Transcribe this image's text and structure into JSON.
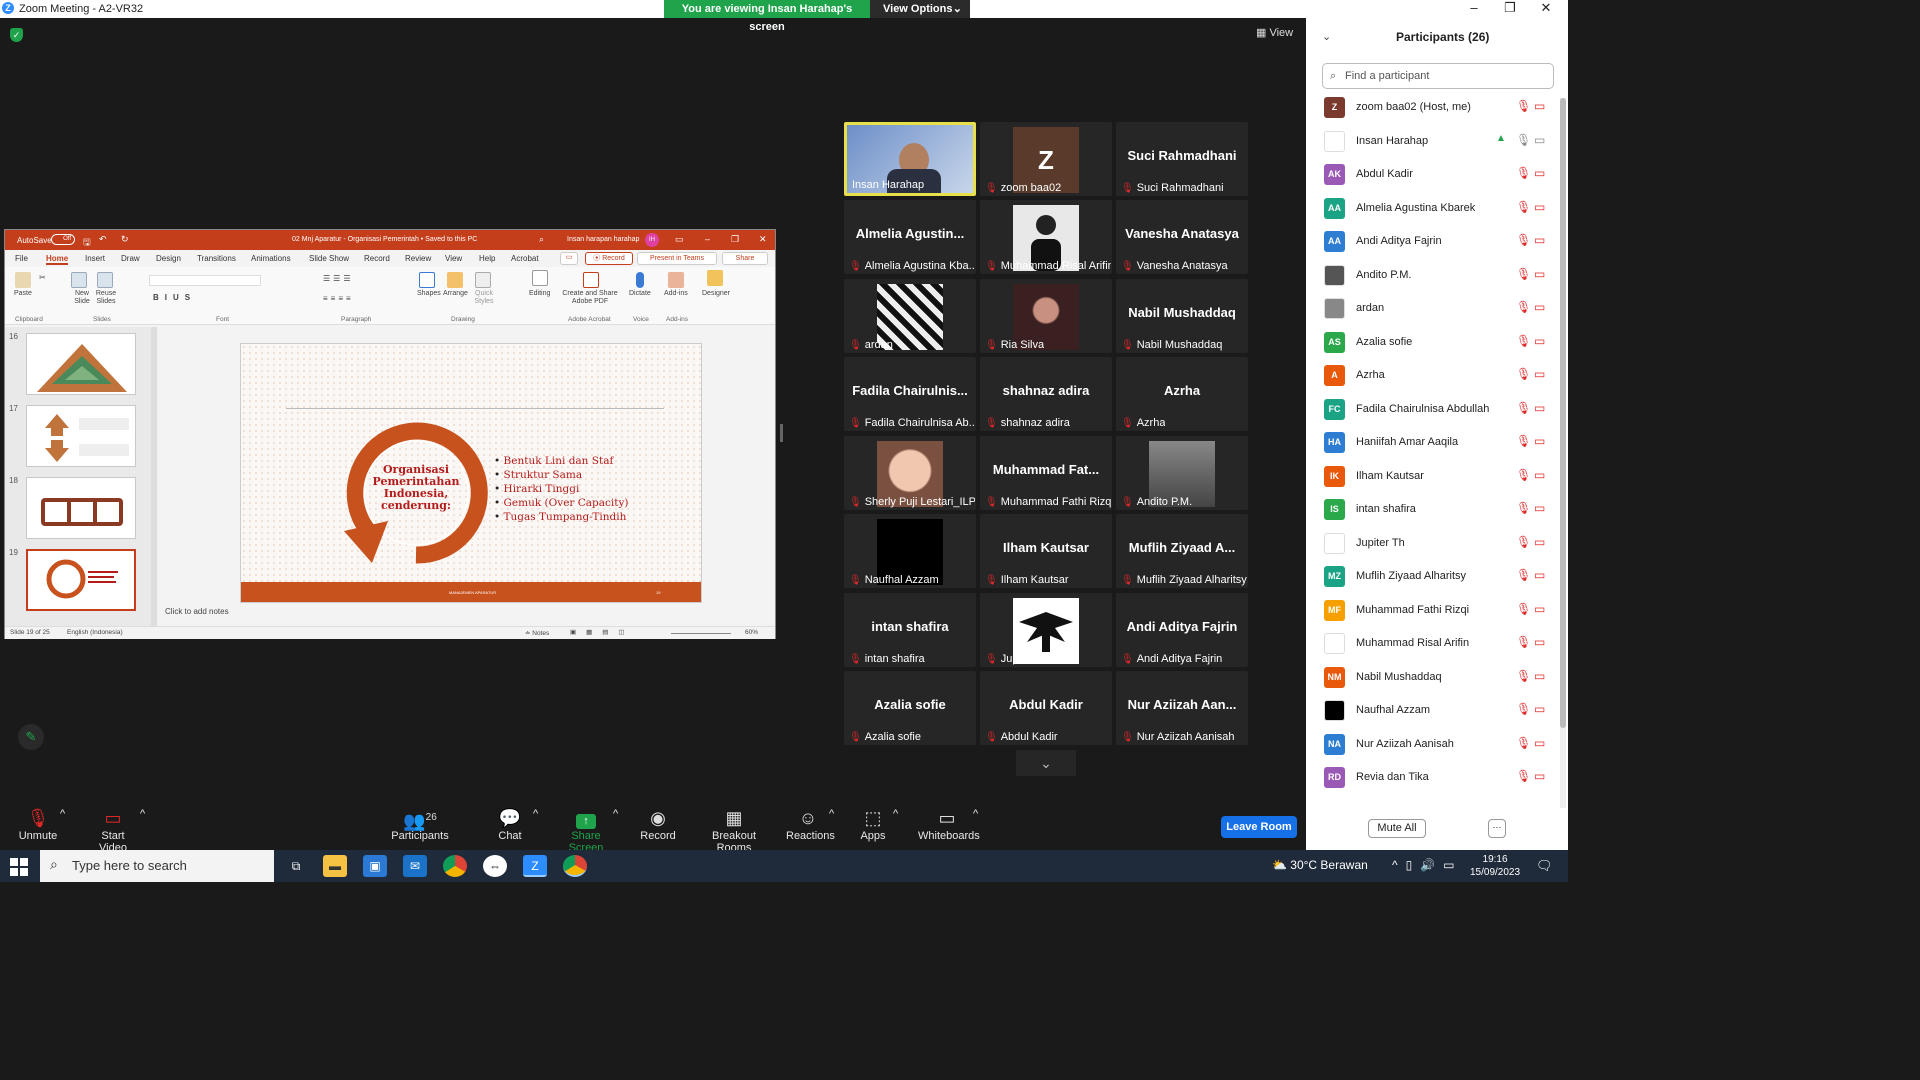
{
  "window": {
    "title": "Zoom Meeting - A2-VR32",
    "viewing_banner": "You are viewing Insan Harahap's screen",
    "view_options": "View Options",
    "view_label": "View"
  },
  "ppt": {
    "autosave": "AutoSave",
    "autosave_state": "Off",
    "doc_title": "02 Mnj Aparatur - Organisasi Pemerintah • Saved to this PC",
    "user": "Insan harapan harahap",
    "user_initials": "IH",
    "tabs": [
      "File",
      "Home",
      "Insert",
      "Draw",
      "Design",
      "Transitions",
      "Animations",
      "Slide Show",
      "Record",
      "Review",
      "View",
      "Help",
      "Acrobat"
    ],
    "record_btn": "Record",
    "present_btn": "Present in Teams",
    "share_btn": "Share",
    "ribbon": {
      "paste": "Paste",
      "new_slide": "New Slide",
      "reuse_slides": "Reuse Slides",
      "shapes": "Shapes",
      "arrange": "Arrange",
      "quick_styles": "Quick Styles",
      "editing": "Editing",
      "create_pdf": "Create and Share Adobe PDF",
      "dictate": "Dictate",
      "addins": "Add-ins",
      "designer": "Designer",
      "groups": [
        "Clipboard",
        "Slides",
        "Font",
        "Paragraph",
        "Drawing",
        "Adobe Acrobat",
        "Voice",
        "Add-ins"
      ]
    },
    "thumb_numbers": [
      "16",
      "17",
      "18",
      "19"
    ],
    "slide": {
      "title": "Organisasi Pemerintahan Indonesia, cenderung:",
      "bullets": [
        "Bentuk Lini dan Staf",
        "Struktur Sama",
        "Hirarki Tinggi",
        "Gemuk (Over Capacity)",
        "Tugas Tumpang-Tindih"
      ],
      "footer": "MANAJEMEN APARATUR",
      "page": "19"
    },
    "notes_placeholder": "Click to add notes",
    "status": {
      "slide_of": "Slide 19 of 25",
      "lang": "English (Indonesia)",
      "notes": "Notes",
      "zoom": "60%"
    }
  },
  "tiles": [
    {
      "name": "Insan Harahap",
      "big": "",
      "muted": false,
      "type": "video"
    },
    {
      "name": "zoom baa02",
      "big": "Z",
      "muted": true,
      "type": "letter"
    },
    {
      "name": "Suci Rahmadhani",
      "big": "Suci Rahmadhani",
      "muted": true,
      "type": "text"
    },
    {
      "name": "Almelia Agustina Kba...",
      "big": "Almelia  Agustin...",
      "muted": true,
      "type": "text"
    },
    {
      "name": "Muhammad Risal Arifin",
      "big": "",
      "muted": true,
      "type": "photo-person"
    },
    {
      "name": "Vanesha Anatasya",
      "big": "Vanesha Anatasya",
      "muted": true,
      "type": "text"
    },
    {
      "name": "ardan",
      "big": "",
      "muted": true,
      "type": "photo-pattern"
    },
    {
      "name": "Ria Silva",
      "big": "",
      "muted": true,
      "type": "photo-dark"
    },
    {
      "name": "Nabil Mushaddaq",
      "big": "Nabil Mushaddaq",
      "muted": true,
      "type": "text"
    },
    {
      "name": "Fadila Chairulnisa Ab...",
      "big": "Fadila  Chairulnis...",
      "muted": true,
      "type": "text"
    },
    {
      "name": "shahnaz adira",
      "big": "shahnaz adira",
      "muted": true,
      "type": "text"
    },
    {
      "name": "Azrha",
      "big": "Azrha",
      "muted": true,
      "type": "text"
    },
    {
      "name": "Sherly Puji Lestari_ILP...",
      "big": "",
      "muted": true,
      "type": "photo-face"
    },
    {
      "name": "Muhammad Fathi Rizqi",
      "big": "Muhammad  Fat...",
      "muted": true,
      "type": "text"
    },
    {
      "name": "Andito P.M.",
      "big": "",
      "muted": true,
      "type": "photo-car"
    },
    {
      "name": "Naufhal Azzam",
      "big": "",
      "muted": true,
      "type": "photo-black"
    },
    {
      "name": "Ilham Kautsar",
      "big": "Ilham Kautsar",
      "muted": true,
      "type": "text"
    },
    {
      "name": "Muflih Ziyaad Alharitsy",
      "big": "Muflih Ziyaad A...",
      "muted": true,
      "type": "text"
    },
    {
      "name": "intan shafira",
      "big": "intan shafira",
      "muted": true,
      "type": "text"
    },
    {
      "name": "Jupiter Th",
      "big": "",
      "muted": true,
      "type": "photo-eagle"
    },
    {
      "name": "Andi Aditya Fajrin",
      "big": "Andi Aditya Fajrin",
      "muted": true,
      "type": "text"
    },
    {
      "name": "Azalia sofie",
      "big": "Azalia sofie",
      "muted": true,
      "type": "text"
    },
    {
      "name": "Abdul Kadir",
      "big": "Abdul Kadir",
      "muted": true,
      "type": "text"
    },
    {
      "name": "Nur Aziizah Aanisah",
      "big": "Nur Aziizah Aan...",
      "muted": true,
      "type": "text"
    }
  ],
  "panel": {
    "title": "Participants (26)",
    "search_placeholder": "Find a participant",
    "mute_all": "Mute All",
    "participants": [
      {
        "initials": "Z",
        "color": "#7a3b2e",
        "name": "zoom baa02 (Host, me)"
      },
      {
        "initials": "",
        "color": "#ffffff",
        "name": "Insan Harahap",
        "sharing": true
      },
      {
        "initials": "AK",
        "color": "#9b59b6",
        "name": "Abdul Kadir"
      },
      {
        "initials": "AA",
        "color": "#1aa385",
        "name": "Almelia Agustina Kbarek"
      },
      {
        "initials": "AA",
        "color": "#2d7dd2",
        "name": "Andi Aditya Fajrin"
      },
      {
        "initials": "",
        "color": "#555555",
        "name": "Andito P.M."
      },
      {
        "initials": "",
        "color": "#888888",
        "name": "ardan"
      },
      {
        "initials": "AS",
        "color": "#2aa84a",
        "name": "Azalia sofie"
      },
      {
        "initials": "A",
        "color": "#e8590c",
        "name": "Azrha"
      },
      {
        "initials": "FC",
        "color": "#1aa385",
        "name": "Fadila Chairulnisa Abdullah"
      },
      {
        "initials": "HA",
        "color": "#2d7dd2",
        "name": "Haniifah Amar Aaqila"
      },
      {
        "initials": "IK",
        "color": "#e8590c",
        "name": "Ilham Kautsar"
      },
      {
        "initials": "IS",
        "color": "#2aa84a",
        "name": "intan shafira"
      },
      {
        "initials": "",
        "color": "#ffffff",
        "name": "Jupiter Th"
      },
      {
        "initials": "MZ",
        "color": "#1aa385",
        "name": "Muflih Ziyaad Alharitsy"
      },
      {
        "initials": "MF",
        "color": "#f59f00",
        "name": "Muhammad Fathi Rizqi"
      },
      {
        "initials": "",
        "color": "#ffffff",
        "name": "Muhammad Risal Arifin"
      },
      {
        "initials": "NM",
        "color": "#e8590c",
        "name": "Nabil Mushaddaq"
      },
      {
        "initials": "",
        "color": "#000000",
        "name": "Naufhal Azzam"
      },
      {
        "initials": "NA",
        "color": "#2d7dd2",
        "name": "Nur Aziizah Aanisah"
      },
      {
        "initials": "RD",
        "color": "#9b59b6",
        "name": "Revia dan Tika"
      }
    ]
  },
  "toolbar": {
    "unmute": "Unmute",
    "start_video": "Start Video",
    "participants": "Participants",
    "participant_count": "26",
    "chat": "Chat",
    "share_screen": "Share Screen",
    "record": "Record",
    "breakout": "Breakout Rooms",
    "reactions": "Reactions",
    "apps": "Apps",
    "whiteboards": "Whiteboards",
    "leave": "Leave Room"
  },
  "taskbar": {
    "search": "Type here to search",
    "weather": "30°C  Berawan",
    "time": "19:16",
    "date": "15/09/2023"
  }
}
